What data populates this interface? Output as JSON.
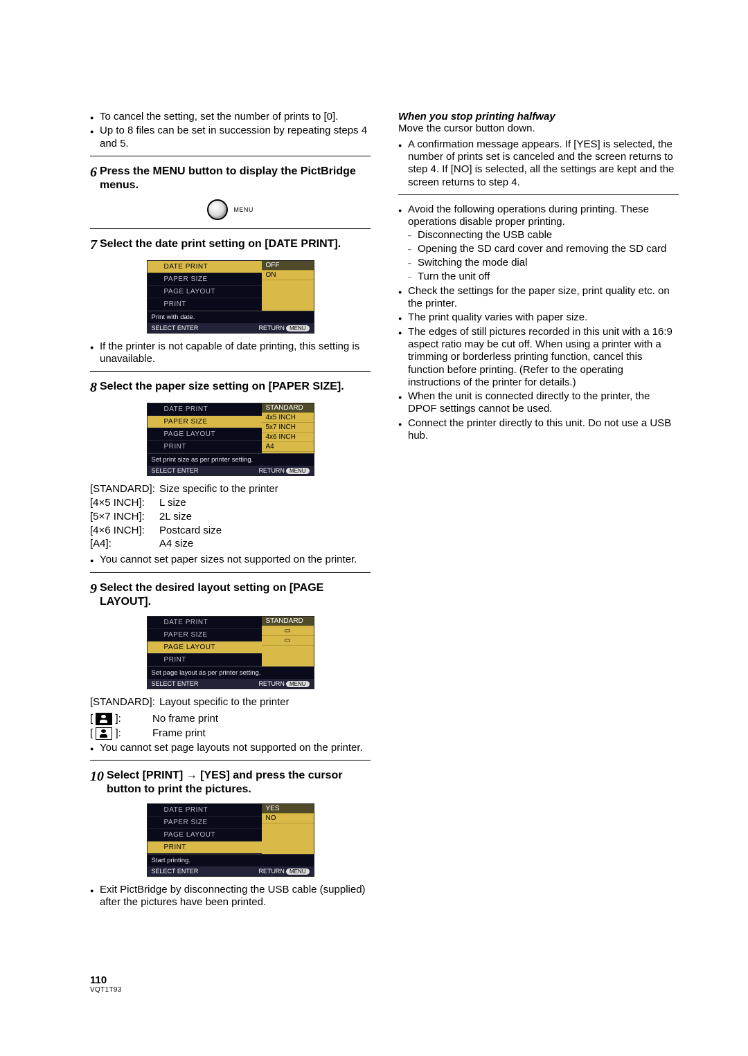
{
  "col1": {
    "pre_bullets": [
      "To cancel the setting, set the number of prints to [0].",
      "Up to 8 files can be set in succession by repeating steps 4 and 5."
    ],
    "step6": {
      "num": "6",
      "title": "Press the MENU button to display the PictBridge menus.",
      "btn_label": "MENU"
    },
    "step7": {
      "num": "7",
      "title": "Select the date print setting on [DATE PRINT].",
      "lcd": {
        "rows": [
          "DATE PRINT",
          "PAPER SIZE",
          "PAGE LAYOUT",
          "PRINT"
        ],
        "opts": [
          "OFF",
          "ON"
        ],
        "hint": "Print with date.",
        "foot_l": "SELECT    ENTER",
        "foot_r": "RETURN",
        "foot_pill": "MENU"
      },
      "note": "If the printer is not capable of date printing, this setting is unavailable."
    },
    "step8": {
      "num": "8",
      "title": "Select the paper size setting on [PAPER SIZE].",
      "lcd": {
        "rows": [
          "DATE PRINT",
          "PAPER SIZE",
          "PAGE LAYOUT",
          "PRINT"
        ],
        "opts": [
          "STANDARD",
          "4x5 INCH",
          "5x7 INCH",
          "4x6 INCH",
          "A4"
        ],
        "hint": "Set print size as per printer setting.",
        "foot_l": "SELECT    ENTER",
        "foot_r": "RETURN",
        "foot_pill": "MENU"
      },
      "defs": [
        {
          "k": "[STANDARD]:",
          "v": "Size specific to the printer"
        },
        {
          "k": "[4×5 INCH]:",
          "v": "L size"
        },
        {
          "k": "[5×7 INCH]:",
          "v": "2L size"
        },
        {
          "k": "[4×6 INCH]:",
          "v": "Postcard size"
        },
        {
          "k": "[A4]:",
          "v": "A4 size"
        }
      ],
      "note": "You cannot set paper sizes not supported on the printer."
    },
    "step9": {
      "num": "9",
      "title": "Select the desired layout setting on [PAGE LAYOUT].",
      "lcd": {
        "rows": [
          "DATE PRINT",
          "PAPER SIZE",
          "PAGE LAYOUT",
          "PRINT"
        ],
        "opts": [
          "STANDARD",
          "",
          ""
        ],
        "hint": "Set page layout as per printer setting.",
        "foot_l": "SELECT    ENTER",
        "foot_r": "RETURN",
        "foot_pill": "MENU"
      },
      "def": {
        "k": "[STANDARD]:",
        "v": "Layout specific to the printer"
      }
    }
  },
  "col2": {
    "iconrows": [
      {
        "label": "No frame print"
      },
      {
        "label": "Frame print"
      }
    ],
    "iconnote": "You cannot set page layouts not supported on the printer.",
    "step10": {
      "num": "10",
      "title": "Select [PRINT] → [YES] and press the cursor button to print the pictures.",
      "lcd": {
        "rows": [
          "DATE PRINT",
          "PAPER SIZE",
          "PAGE LAYOUT",
          "PRINT"
        ],
        "opts": [
          "YES",
          "NO"
        ],
        "hint": "Start printing.",
        "foot_l": "SELECT    ENTER",
        "foot_r": "RETURN",
        "foot_pill": "MENU"
      },
      "note": "Exit PictBridge by disconnecting the USB cable (supplied) after the pictures have been printed."
    },
    "halfway_head": "When you stop printing halfway",
    "halfway_body": "Move the cursor button down.",
    "halfway_bullet": "A confirmation message appears. If [YES] is selected, the number of prints set is canceled and the screen returns to step 4. If [NO] is selected, all the settings are kept and the screen returns to step 4.",
    "avoid_lead": "Avoid the following operations during printing. These operations disable proper printing.",
    "avoid_items": [
      "Disconnecting the USB cable",
      "Opening the SD card cover and removing the SD card",
      "Switching the mode dial",
      "Turn the unit off"
    ],
    "tail_bullets": [
      "Check the settings for the paper size, print quality etc. on the printer.",
      "The print quality varies with paper size.",
      "The edges of still pictures recorded in this unit with a 16:9 aspect ratio may be cut off. When using a printer with a trimming or borderless printing function, cancel this function before printing. (Refer to the operating instructions of the printer for details.)",
      "When the unit is connected directly to the printer, the DPOF settings cannot be used.",
      "Connect the printer directly to this unit. Do not use a USB hub."
    ]
  },
  "footer": {
    "page": "110",
    "code": "VQT1T93"
  }
}
